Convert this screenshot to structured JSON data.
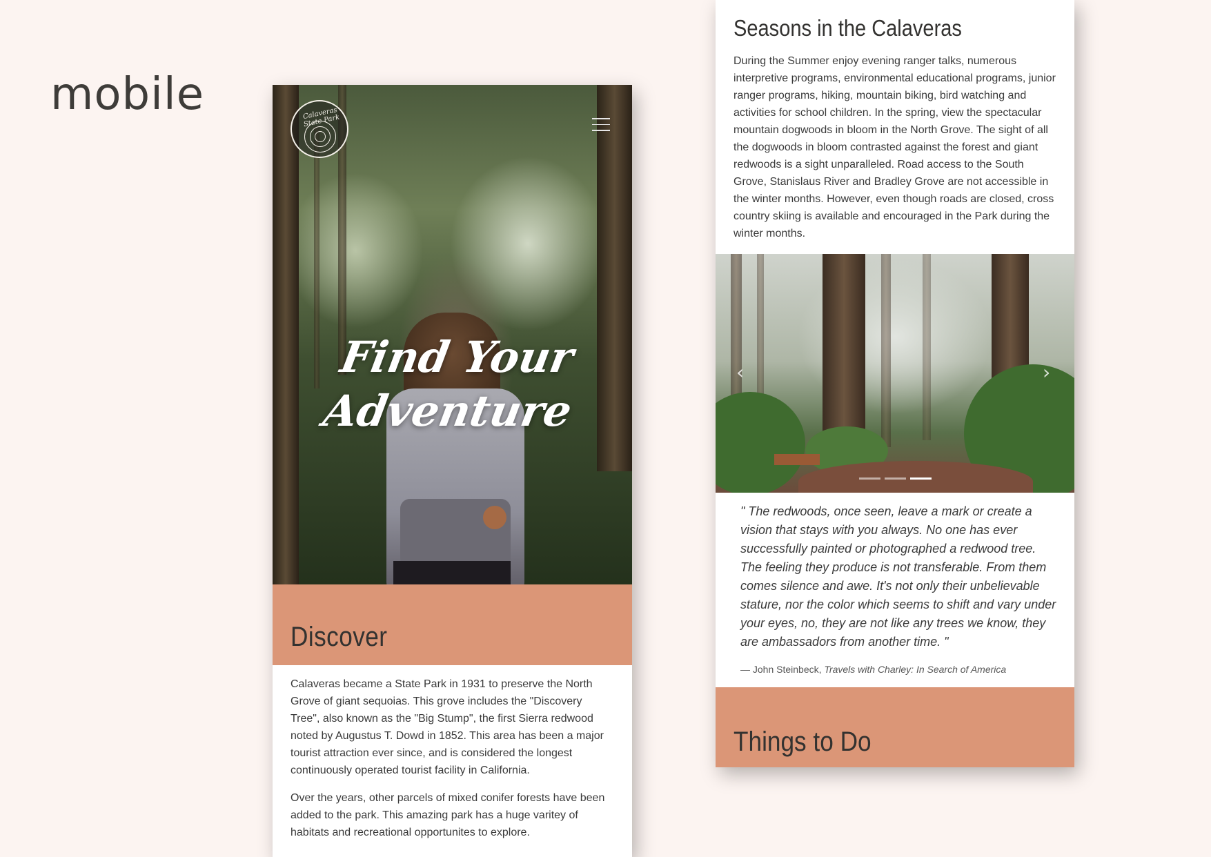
{
  "label": "mobile",
  "colors": {
    "background": "#fcf4f1",
    "accent": "#db9677",
    "text": "#333230"
  },
  "screen1": {
    "logo_text": "Calaveras State Park",
    "menu_icon": "hamburger-menu-icon",
    "hero_title_line1": "Find Your",
    "hero_title_line2": "Adventure",
    "section_title": "Discover",
    "paragraphs": [
      "Calaveras became a State Park in 1931 to preserve the North Grove of giant sequoias. This grove includes the \"Discovery Tree\", also known as the \"Big Stump\", the first Sierra redwood noted by Augustus T. Dowd in 1852. This area has been a major tourist attraction ever since, and is considered the longest continuously operated tourist facility in California.",
      "Over the years, other parcels of mixed conifer forests have been added to the park. This amazing park has a huge varitey of habitats and recreational opportunites to explore."
    ]
  },
  "screen2": {
    "section_title": "Seasons in the Calaveras",
    "paragraph": "During the Summer enjoy evening ranger talks, numerous interpretive programs, environmental educational programs, junior ranger programs, hiking, mountain biking, bird watching and activities for school children. In the spring, view the spectacular mountain dogwoods in bloom in the North Grove. The sight of all the dogwoods in bloom contrasted against the forest and giant redwoods is a sight unparalleled. Road access to the South Grove, Stanislaus River and Bradley Grove are not accessible in the winter months. However, even though roads are closed, cross country skiing is available and encouraged in the Park during the winter months.",
    "carousel": {
      "prev_icon": "chevron-left-icon",
      "next_icon": "chevron-right-icon",
      "prev_glyph": "‹",
      "next_glyph": "›",
      "slide_count": 3,
      "active_slide": 3
    },
    "quote": "\" The redwoods, once seen, leave a mark or create a vision that stays with you always. No one has ever successfully painted or photographed a redwood tree. The feeling they produce is not transferable. From them comes silence and awe. It's not only their unbelievable stature, nor the color which seems to shift and vary under your eyes, no, they are not like any trees we know, they are ambassadors from another time. \"",
    "cite_author": "— John Steinbeck,",
    "cite_work": "Travels with Charley: In Search of America",
    "next_section_title": "Things to Do"
  }
}
